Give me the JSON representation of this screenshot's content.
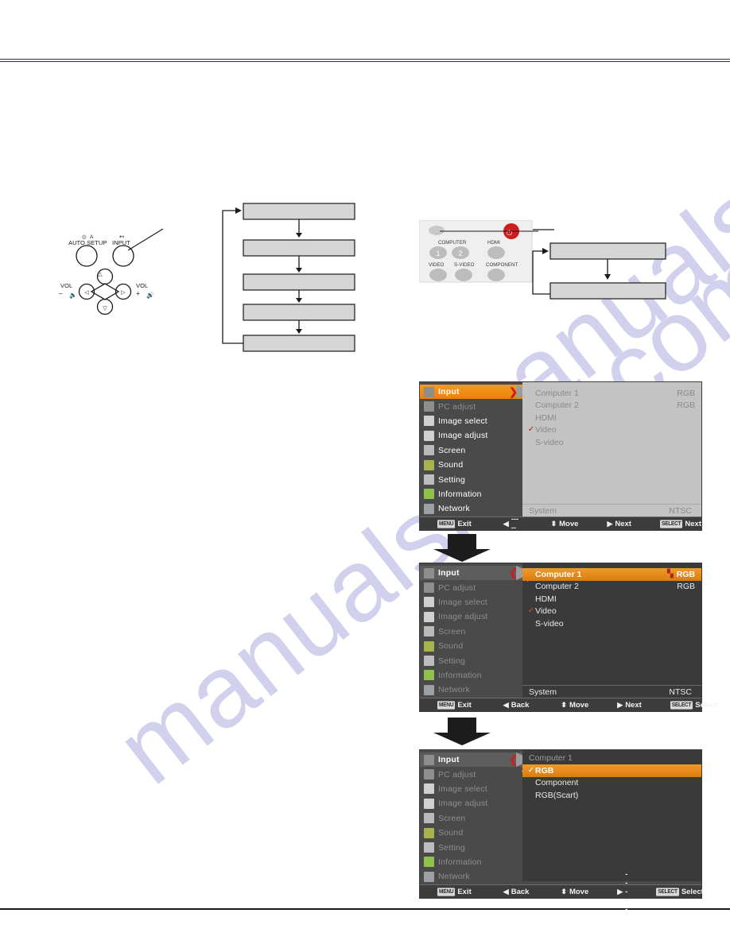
{
  "document": {
    "watermark": "manualshive.com"
  },
  "remote_diagram": {
    "name": "remote-control-keypad",
    "labels": {
      "auto_setup": "AUTO SETUP",
      "input": "INPUT",
      "vol_left": "VOL",
      "vol_left_minus": "–",
      "vol_right": "VOL",
      "vol_right_plus": "+"
    }
  },
  "flow_left": {
    "name": "input-cycle-flow",
    "steps": [
      "",
      "",
      "",
      "",
      ""
    ]
  },
  "control_panel": {
    "name": "projector-control-panel",
    "buttons": [
      {
        "label": "COMPUTER",
        "digit": "1"
      },
      {
        "label": "",
        "digit": "2"
      },
      {
        "label": "HDMI",
        "digit": ""
      },
      {
        "label": "VIDEO",
        "digit": ""
      },
      {
        "label": "S-VIDEO",
        "digit": ""
      },
      {
        "label": "COMPONENT",
        "digit": ""
      }
    ]
  },
  "flow_right": {
    "name": "source-select-flow",
    "steps": [
      "",
      ""
    ]
  },
  "menus": [
    {
      "id": "menu-input-highlighted",
      "sidebar": [
        {
          "label": "Input",
          "icon": "input-icon",
          "state": "selected"
        },
        {
          "label": "PC adjust",
          "icon": "pc-adjust-icon",
          "state": "disabled"
        },
        {
          "label": "Image select",
          "icon": "image-select-icon",
          "state": "normal"
        },
        {
          "label": "Image adjust",
          "icon": "image-adjust-icon",
          "state": "normal"
        },
        {
          "label": "Screen",
          "icon": "screen-icon",
          "state": "normal"
        },
        {
          "label": "Sound",
          "icon": "sound-icon",
          "state": "normal"
        },
        {
          "label": "Setting",
          "icon": "setting-icon",
          "state": "normal"
        },
        {
          "label": "Information",
          "icon": "information-icon",
          "state": "normal"
        },
        {
          "label": "Network",
          "icon": "network-icon",
          "state": "normal"
        }
      ],
      "sidebar_arrow": "❯",
      "panel_state": "inactive",
      "panel_header": "",
      "options": [
        {
          "name": "Computer 1",
          "value": "RGB",
          "checked": false,
          "highlighted": false,
          "flag": false
        },
        {
          "name": "Computer 2",
          "value": "RGB",
          "checked": false,
          "highlighted": false,
          "flag": false
        },
        {
          "name": "HDMI",
          "value": "",
          "checked": false,
          "highlighted": false,
          "flag": false
        },
        {
          "name": "Video",
          "value": "",
          "checked": true,
          "highlighted": false,
          "flag": false
        },
        {
          "name": "S-video",
          "value": "",
          "checked": false,
          "highlighted": false,
          "flag": false
        }
      ],
      "system": {
        "label": "System",
        "value": "NTSC"
      },
      "guide": [
        {
          "key": "MENU",
          "text": "Exit"
        },
        {
          "glyph": "◀",
          "text": "-----"
        },
        {
          "glyph": "⬍",
          "text": "Move"
        },
        {
          "glyph": "▶",
          "text": "Next"
        },
        {
          "key": "SELECT",
          "text": "Next"
        }
      ]
    },
    {
      "id": "menu-input-list-active",
      "sidebar": [
        {
          "label": "Input",
          "icon": "input-icon",
          "state": "selected-gray"
        },
        {
          "label": "PC adjust",
          "icon": "pc-adjust-icon",
          "state": "disabled"
        },
        {
          "label": "Image select",
          "icon": "image-select-icon",
          "state": "normal"
        },
        {
          "label": "Image adjust",
          "icon": "image-adjust-icon",
          "state": "normal"
        },
        {
          "label": "Screen",
          "icon": "screen-icon",
          "state": "normal"
        },
        {
          "label": "Sound",
          "icon": "sound-icon",
          "state": "normal"
        },
        {
          "label": "Setting",
          "icon": "setting-icon",
          "state": "normal"
        },
        {
          "label": "Information",
          "icon": "information-icon",
          "state": "normal"
        },
        {
          "label": "Network",
          "icon": "network-icon",
          "state": "normal"
        }
      ],
      "sidebar_arrow": "❮",
      "panel_state": "active",
      "panel_header": "",
      "options": [
        {
          "name": "Computer 1",
          "value": "RGB",
          "checked": false,
          "highlighted": true,
          "flag": true
        },
        {
          "name": "Computer 2",
          "value": "RGB",
          "checked": false,
          "highlighted": false,
          "flag": false
        },
        {
          "name": "HDMI",
          "value": "",
          "checked": false,
          "highlighted": false,
          "flag": false
        },
        {
          "name": "Video",
          "value": "",
          "checked": true,
          "highlighted": false,
          "flag": false
        },
        {
          "name": "S-video",
          "value": "",
          "checked": false,
          "highlighted": false,
          "flag": false
        }
      ],
      "system": {
        "label": "System",
        "value": "NTSC"
      },
      "guide": [
        {
          "key": "MENU",
          "text": "Exit"
        },
        {
          "glyph": "◀",
          "text": "Back"
        },
        {
          "glyph": "⬍",
          "text": "Move"
        },
        {
          "glyph": "▶",
          "text": "Next"
        },
        {
          "key": "SELECT",
          "text": "Select"
        }
      ]
    },
    {
      "id": "menu-computer1-source",
      "sidebar": [
        {
          "label": "Input",
          "icon": "input-icon",
          "state": "selected-gray"
        },
        {
          "label": "PC adjust",
          "icon": "pc-adjust-icon",
          "state": "disabled"
        },
        {
          "label": "Image select",
          "icon": "image-select-icon",
          "state": "normal"
        },
        {
          "label": "Image adjust",
          "icon": "image-adjust-icon",
          "state": "normal"
        },
        {
          "label": "Screen",
          "icon": "screen-icon",
          "state": "normal"
        },
        {
          "label": "Sound",
          "icon": "sound-icon",
          "state": "normal"
        },
        {
          "label": "Setting",
          "icon": "setting-icon",
          "state": "normal"
        },
        {
          "label": "Information",
          "icon": "information-icon",
          "state": "normal"
        },
        {
          "label": "Network",
          "icon": "network-icon",
          "state": "normal"
        }
      ],
      "sidebar_arrow": "❮",
      "panel_state": "active",
      "panel_header": "Computer 1",
      "options": [
        {
          "name": "RGB",
          "value": "",
          "checked": true,
          "highlighted": true,
          "flag": false
        },
        {
          "name": "Component",
          "value": "",
          "checked": false,
          "highlighted": false,
          "flag": false
        },
        {
          "name": "RGB(Scart)",
          "value": "",
          "checked": false,
          "highlighted": false,
          "flag": false
        }
      ],
      "system": {
        "label": "",
        "value": ""
      },
      "guide": [
        {
          "key": "MENU",
          "text": "Exit"
        },
        {
          "glyph": "◀",
          "text": "Back"
        },
        {
          "glyph": "⬍",
          "text": "Move"
        },
        {
          "glyph": "▶",
          "text": "-----"
        },
        {
          "key": "SELECT",
          "text": "Select"
        }
      ]
    }
  ],
  "colors": {
    "highlight_orange": "#e8820c",
    "menu_gray": "#4a4a4a",
    "panel_inactive": "#c3c3c3",
    "panel_active": "#3a3a3a",
    "red_arrow": "#cf1b1b",
    "watermark": "#c9c8ea"
  }
}
